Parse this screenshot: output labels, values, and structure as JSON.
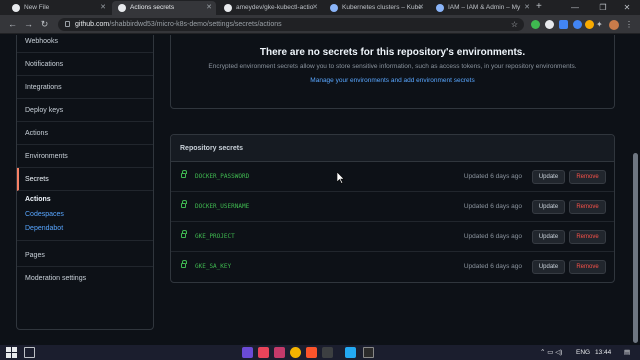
{
  "browser": {
    "tabs": [
      {
        "label": "New File"
      },
      {
        "label": "Actions secrets"
      },
      {
        "label": "ameydev/gke-kubectl-actio"
      },
      {
        "label": "Kubernetes clusters – Kube"
      },
      {
        "label": "IAM – IAM & Admin – My"
      }
    ],
    "new_tab": "+",
    "url_host": "github.com",
    "url_path": "/shabbirdwd53/micro-k8s-demo/settings/secrets/actions"
  },
  "sidebar": {
    "items": [
      {
        "label": "Webhooks"
      },
      {
        "label": "Notifications"
      },
      {
        "label": "Integrations"
      },
      {
        "label": "Deploy keys"
      },
      {
        "label": "Actions"
      },
      {
        "label": "Environments"
      },
      {
        "label": "Secrets"
      }
    ],
    "group_title": "Actions",
    "group_links": [
      {
        "label": "Codespaces"
      },
      {
        "label": "Dependabot"
      }
    ],
    "bottom_items": [
      {
        "label": "Pages"
      },
      {
        "label": "Moderation settings"
      }
    ]
  },
  "environments": {
    "heading": "There are no secrets for this repository's environments.",
    "description": "Encrypted environment secrets allow you to store sensitive information, such as access tokens, in your repository environments.",
    "link": "Manage your environments and add environment secrets"
  },
  "repo_secrets": {
    "title": "Repository secrets",
    "rows": [
      {
        "name": "DOCKER_PASSWORD",
        "updated": "Updated 6 days ago",
        "update_label": "Update",
        "remove_label": "Remove"
      },
      {
        "name": "DOCKER_USERNAME",
        "updated": "Updated 6 days ago",
        "update_label": "Update",
        "remove_label": "Remove"
      },
      {
        "name": "GKE_PROJECT",
        "updated": "Updated 6 days ago",
        "update_label": "Update",
        "remove_label": "Remove"
      },
      {
        "name": "GKE_SA_KEY",
        "updated": "Updated 6 days ago",
        "update_label": "Update",
        "remove_label": "Remove"
      }
    ]
  },
  "taskbar": {
    "lang": "ENG",
    "time": "13:44"
  },
  "colors": {
    "accent": "#58a6ff",
    "secret_name": "#3fb950",
    "danger": "#f85149",
    "active_marker": "#f78166"
  }
}
